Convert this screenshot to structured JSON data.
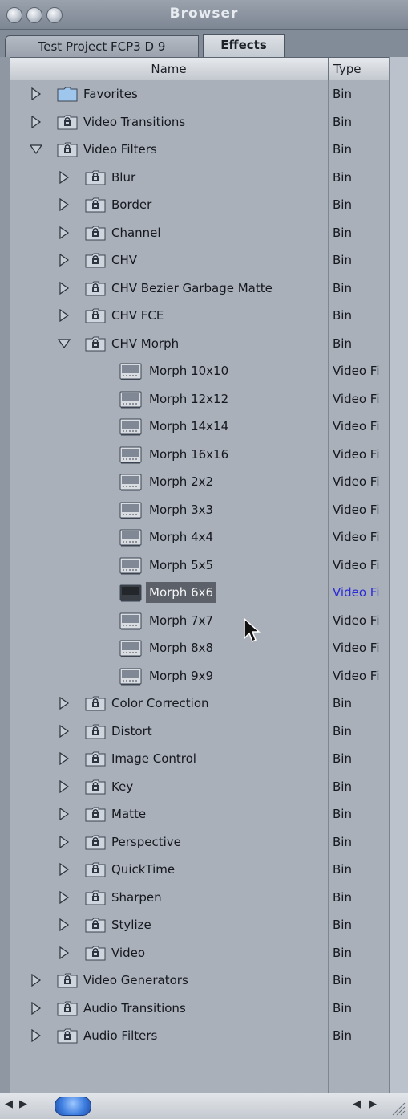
{
  "window": {
    "title": "Browser"
  },
  "tabs": [
    {
      "label": "Test Project FCP3 D 9"
    },
    {
      "label": "Effects"
    }
  ],
  "columns": {
    "name": "Name",
    "type": "Type"
  },
  "rows": [
    {
      "label": "Favorites",
      "type": "Bin",
      "kind": "folder",
      "depth": 0,
      "expanded": false,
      "locked": false
    },
    {
      "label": "Video Transitions",
      "type": "Bin",
      "kind": "folder",
      "depth": 0,
      "expanded": false,
      "locked": true
    },
    {
      "label": "Video Filters",
      "type": "Bin",
      "kind": "folder",
      "depth": 0,
      "expanded": true,
      "locked": true
    },
    {
      "label": "Blur",
      "type": "Bin",
      "kind": "folder",
      "depth": 1,
      "expanded": false,
      "locked": true
    },
    {
      "label": "Border",
      "type": "Bin",
      "kind": "folder",
      "depth": 1,
      "expanded": false,
      "locked": true
    },
    {
      "label": "Channel",
      "type": "Bin",
      "kind": "folder",
      "depth": 1,
      "expanded": false,
      "locked": true
    },
    {
      "label": "CHV",
      "type": "Bin",
      "kind": "folder",
      "depth": 1,
      "expanded": false,
      "locked": true
    },
    {
      "label": "CHV Bezier Garbage Matte",
      "type": "Bin",
      "kind": "folder",
      "depth": 1,
      "expanded": false,
      "locked": true
    },
    {
      "label": "CHV FCE",
      "type": "Bin",
      "kind": "folder",
      "depth": 1,
      "expanded": false,
      "locked": true
    },
    {
      "label": "CHV Morph",
      "type": "Bin",
      "kind": "folder",
      "depth": 1,
      "expanded": true,
      "locked": true
    },
    {
      "label": "Morph 10x10",
      "type": "Video Fi",
      "kind": "filter",
      "depth": 2
    },
    {
      "label": "Morph 12x12",
      "type": "Video Fi",
      "kind": "filter",
      "depth": 2
    },
    {
      "label": "Morph 14x14",
      "type": "Video Fi",
      "kind": "filter",
      "depth": 2
    },
    {
      "label": "Morph 16x16",
      "type": "Video Fi",
      "kind": "filter",
      "depth": 2
    },
    {
      "label": "Morph 2x2",
      "type": "Video Fi",
      "kind": "filter",
      "depth": 2
    },
    {
      "label": "Morph 3x3",
      "type": "Video Fi",
      "kind": "filter",
      "depth": 2
    },
    {
      "label": "Morph 4x4",
      "type": "Video Fi",
      "kind": "filter",
      "depth": 2
    },
    {
      "label": "Morph 5x5",
      "type": "Video Fi",
      "kind": "filter",
      "depth": 2
    },
    {
      "label": "Morph 6x6",
      "type": "Video Fi",
      "kind": "filter",
      "depth": 2,
      "selected": true
    },
    {
      "label": "Morph 7x7",
      "type": "Video Fi",
      "kind": "filter",
      "depth": 2
    },
    {
      "label": "Morph 8x8",
      "type": "Video Fi",
      "kind": "filter",
      "depth": 2
    },
    {
      "label": "Morph 9x9",
      "type": "Video Fi",
      "kind": "filter",
      "depth": 2
    },
    {
      "label": "Color Correction",
      "type": "Bin",
      "kind": "folder",
      "depth": 1,
      "expanded": false,
      "locked": true
    },
    {
      "label": "Distort",
      "type": "Bin",
      "kind": "folder",
      "depth": 1,
      "expanded": false,
      "locked": true
    },
    {
      "label": "Image Control",
      "type": "Bin",
      "kind": "folder",
      "depth": 1,
      "expanded": false,
      "locked": true
    },
    {
      "label": "Key",
      "type": "Bin",
      "kind": "folder",
      "depth": 1,
      "expanded": false,
      "locked": true
    },
    {
      "label": "Matte",
      "type": "Bin",
      "kind": "folder",
      "depth": 1,
      "expanded": false,
      "locked": true
    },
    {
      "label": "Perspective",
      "type": "Bin",
      "kind": "folder",
      "depth": 1,
      "expanded": false,
      "locked": true
    },
    {
      "label": "QuickTime",
      "type": "Bin",
      "kind": "folder",
      "depth": 1,
      "expanded": false,
      "locked": true
    },
    {
      "label": "Sharpen",
      "type": "Bin",
      "kind": "folder",
      "depth": 1,
      "expanded": false,
      "locked": true
    },
    {
      "label": "Stylize",
      "type": "Bin",
      "kind": "folder",
      "depth": 1,
      "expanded": false,
      "locked": true
    },
    {
      "label": "Video",
      "type": "Bin",
      "kind": "folder",
      "depth": 1,
      "expanded": false,
      "locked": true
    },
    {
      "label": "Video Generators",
      "type": "Bin",
      "kind": "folder",
      "depth": 0,
      "expanded": false,
      "locked": true
    },
    {
      "label": "Audio Transitions",
      "type": "Bin",
      "kind": "folder",
      "depth": 0,
      "expanded": false,
      "locked": true
    },
    {
      "label": "Audio Filters",
      "type": "Bin",
      "kind": "folder",
      "depth": 0,
      "expanded": false,
      "locked": true
    }
  ],
  "colors": {
    "selection": "#5c6068",
    "selected_type_text": "#2b2bd6",
    "list_bg": "#a9b0ba"
  }
}
